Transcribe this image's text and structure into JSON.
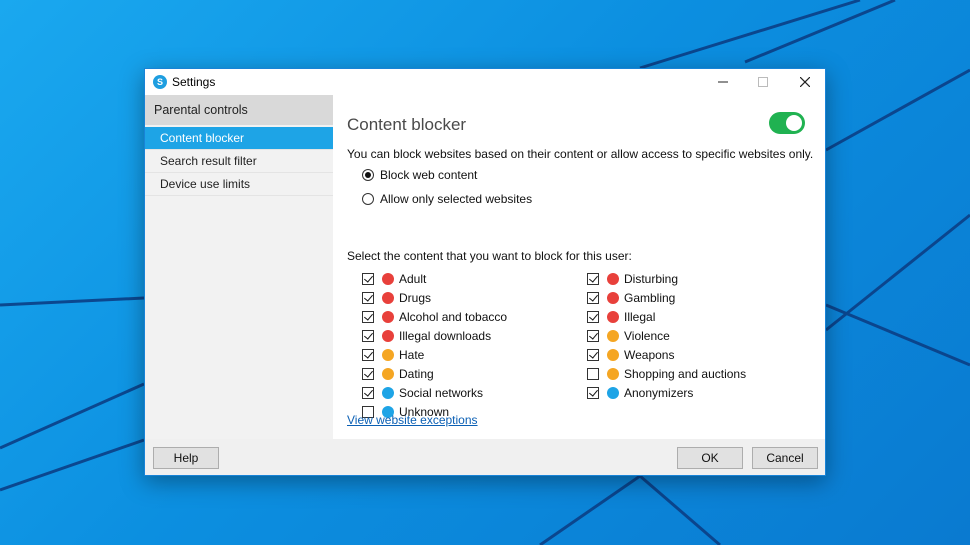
{
  "window": {
    "title": "Settings",
    "close_glyph": "✕"
  },
  "sidebar": {
    "header": "Parental controls",
    "items": [
      {
        "label": "Content blocker"
      },
      {
        "label": "Search result filter"
      },
      {
        "label": "Device use limits"
      }
    ]
  },
  "content": {
    "title": "Content blocker",
    "toggle_on": true,
    "description": "You can block websites based on their content or allow access to specific websites only.",
    "radio_options": [
      {
        "label": "Block web content",
        "selected": true
      },
      {
        "label": "Allow only selected websites",
        "selected": false
      }
    ],
    "select_label": "Select the content that you want to block for this user:",
    "categories_left": [
      {
        "label": "Adult",
        "checked": true,
        "icon": "adult-icon",
        "color": "#e8403b"
      },
      {
        "label": "Drugs",
        "checked": true,
        "icon": "drugs-icon",
        "color": "#e8403b"
      },
      {
        "label": "Alcohol and tobacco",
        "checked": true,
        "icon": "alcohol-icon",
        "color": "#e8403b"
      },
      {
        "label": "Illegal downloads",
        "checked": true,
        "icon": "download-icon",
        "color": "#e8403b"
      },
      {
        "label": "Hate",
        "checked": true,
        "icon": "hate-icon",
        "color": "#f5a623"
      },
      {
        "label": "Dating",
        "checked": true,
        "icon": "dating-icon",
        "color": "#f5a623"
      },
      {
        "label": "Social networks",
        "checked": true,
        "icon": "social-icon",
        "color": "#1ea4e6"
      },
      {
        "label": "Unknown",
        "checked": false,
        "icon": "unknown-icon",
        "color": "#1ea4e6"
      }
    ],
    "categories_right": [
      {
        "label": "Disturbing",
        "checked": true,
        "icon": "disturbing-icon",
        "color": "#e8403b"
      },
      {
        "label": "Gambling",
        "checked": true,
        "icon": "gambling-icon",
        "color": "#e8403b"
      },
      {
        "label": "Illegal",
        "checked": true,
        "icon": "illegal-icon",
        "color": "#e8403b"
      },
      {
        "label": "Violence",
        "checked": true,
        "icon": "violence-icon",
        "color": "#f5a623"
      },
      {
        "label": "Weapons",
        "checked": true,
        "icon": "weapons-icon",
        "color": "#f5a623"
      },
      {
        "label": "Shopping and auctions",
        "checked": false,
        "icon": "shopping-icon",
        "color": "#f5a623"
      },
      {
        "label": "Anonymizers",
        "checked": true,
        "icon": "anonymizers-icon",
        "color": "#1ea4e6"
      }
    ],
    "exceptions_link": "View website exceptions"
  },
  "footer": {
    "help_label": "Help",
    "ok_label": "OK",
    "cancel_label": "Cancel"
  }
}
